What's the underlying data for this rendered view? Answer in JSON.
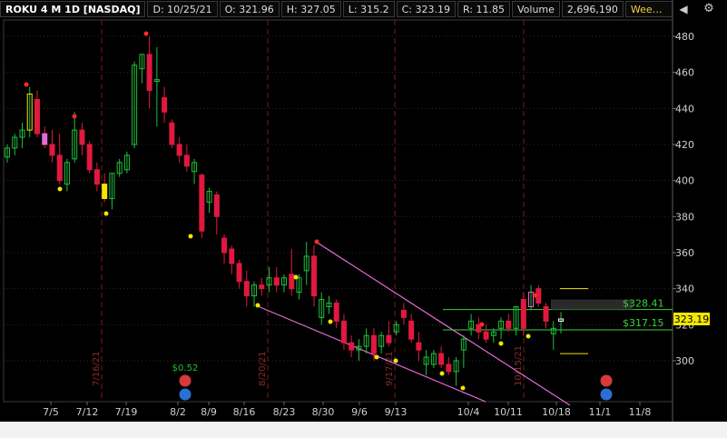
{
  "header": {
    "symbol": "ROKU 4 M 1D [NASDAQ]",
    "d_label": "D:",
    "d_value": "10/25/21",
    "o_label": "O:",
    "o_value": "321.96",
    "h_label": "H:",
    "h_value": "327.05",
    "l_label": "L:",
    "l_value": "315.2",
    "c_label": "C:",
    "c_value": "323.19",
    "r_label": "R:",
    "r_value": "11.85",
    "volume_label": "Volume",
    "volume_value": "2,696,190",
    "study_label": "WeeklyHighLowPlot (WEEK,..."
  },
  "icons": {
    "collapse": "chevron-left-icon",
    "settings": "gear-icon"
  },
  "price_axis": {
    "ticks": [
      "480",
      "460",
      "440",
      "420",
      "400",
      "380",
      "360",
      "340",
      "320",
      "300"
    ],
    "last_price": "323.19"
  },
  "date_axis": {
    "labels": [
      "7/5",
      "7/12",
      "7/19",
      "8/2",
      "8/9",
      "8/16",
      "8/23",
      "8/30",
      "9/6",
      "9/13",
      "10/4",
      "10/11",
      "10/18",
      "11/1",
      "11/8"
    ]
  },
  "annotations": {
    "weekly_high": "$328.41",
    "weekly_low": "$317.15",
    "dividend": "$0.52",
    "earnings_markers": [
      "7/16/21",
      "8/20/21",
      "9/17/21",
      "10/15/21"
    ]
  },
  "colors": {
    "up": "#1fbf3a",
    "down": "#e0193f",
    "magenta": "#e06bd6",
    "yellow": "#f2e600",
    "green_line": "#3ecf3e",
    "price_tag": "#f2e600"
  },
  "chart_data": {
    "type": "candlestick",
    "ylim": [
      280,
      490
    ],
    "candles": [
      {
        "o": 413,
        "h": 420,
        "l": 410,
        "c": 418
      },
      {
        "o": 418,
        "h": 426,
        "l": 414,
        "c": 424
      },
      {
        "o": 424,
        "h": 432,
        "l": 418,
        "c": 428
      },
      {
        "o": 428,
        "h": 452,
        "l": 424,
        "c": 448
      },
      {
        "o": 445,
        "h": 450,
        "l": 424,
        "c": 426
      },
      {
        "o": 426,
        "h": 430,
        "l": 418,
        "c": 420
      },
      {
        "o": 420,
        "h": 428,
        "l": 410,
        "c": 414
      },
      {
        "o": 414,
        "h": 426,
        "l": 398,
        "c": 400
      },
      {
        "o": 398,
        "h": 412,
        "l": 394,
        "c": 410
      },
      {
        "o": 412,
        "h": 438,
        "l": 410,
        "c": 428
      },
      {
        "o": 428,
        "h": 432,
        "l": 414,
        "c": 420
      },
      {
        "o": 420,
        "h": 422,
        "l": 404,
        "c": 406
      },
      {
        "o": 406,
        "h": 410,
        "l": 394,
        "c": 398
      },
      {
        "o": 398,
        "h": 404,
        "l": 388,
        "c": 390
      },
      {
        "o": 390,
        "h": 404,
        "l": 384,
        "c": 404
      },
      {
        "o": 404,
        "h": 412,
        "l": 402,
        "c": 410
      },
      {
        "o": 406,
        "h": 416,
        "l": 404,
        "c": 414
      },
      {
        "o": 420,
        "h": 466,
        "l": 418,
        "c": 464
      },
      {
        "o": 462,
        "h": 470,
        "l": 454,
        "c": 470
      },
      {
        "o": 470,
        "h": 480,
        "l": 440,
        "c": 450
      },
      {
        "o": 455,
        "h": 474,
        "l": 430,
        "c": 456
      },
      {
        "o": 446,
        "h": 452,
        "l": 432,
        "c": 438
      },
      {
        "o": 432,
        "h": 434,
        "l": 418,
        "c": 420
      },
      {
        "o": 420,
        "h": 424,
        "l": 410,
        "c": 414
      },
      {
        "o": 414,
        "h": 420,
        "l": 405,
        "c": 408
      },
      {
        "o": 405,
        "h": 412,
        "l": 398,
        "c": 410
      },
      {
        "o": 403,
        "h": 404,
        "l": 368,
        "c": 372
      },
      {
        "o": 388,
        "h": 396,
        "l": 382,
        "c": 394
      },
      {
        "o": 392,
        "h": 394,
        "l": 370,
        "c": 380
      },
      {
        "o": 368,
        "h": 370,
        "l": 354,
        "c": 360
      },
      {
        "o": 362,
        "h": 364,
        "l": 348,
        "c": 354
      },
      {
        "o": 354,
        "h": 356,
        "l": 340,
        "c": 344
      },
      {
        "o": 344,
        "h": 350,
        "l": 330,
        "c": 336
      },
      {
        "o": 336,
        "h": 344,
        "l": 330,
        "c": 342
      },
      {
        "o": 342,
        "h": 346,
        "l": 336,
        "c": 340
      },
      {
        "o": 342,
        "h": 352,
        "l": 338,
        "c": 346
      },
      {
        "o": 346,
        "h": 352,
        "l": 338,
        "c": 342
      },
      {
        "o": 342,
        "h": 348,
        "l": 338,
        "c": 346
      },
      {
        "o": 348,
        "h": 362,
        "l": 336,
        "c": 340
      },
      {
        "o": 338,
        "h": 348,
        "l": 334,
        "c": 346
      },
      {
        "o": 350,
        "h": 366,
        "l": 342,
        "c": 358
      },
      {
        "o": 358,
        "h": 364,
        "l": 330,
        "c": 336
      },
      {
        "o": 324,
        "h": 338,
        "l": 320,
        "c": 334
      },
      {
        "o": 330,
        "h": 336,
        "l": 326,
        "c": 332
      },
      {
        "o": 332,
        "h": 334,
        "l": 318,
        "c": 322
      },
      {
        "o": 322,
        "h": 326,
        "l": 306,
        "c": 310
      },
      {
        "o": 310,
        "h": 314,
        "l": 302,
        "c": 306
      },
      {
        "o": 306,
        "h": 312,
        "l": 300,
        "c": 308
      },
      {
        "o": 308,
        "h": 318,
        "l": 304,
        "c": 314
      },
      {
        "o": 314,
        "h": 318,
        "l": 300,
        "c": 304
      },
      {
        "o": 308,
        "h": 316,
        "l": 304,
        "c": 314
      },
      {
        "o": 314,
        "h": 322,
        "l": 308,
        "c": 310
      },
      {
        "o": 316,
        "h": 322,
        "l": 314,
        "c": 320
      },
      {
        "o": 328,
        "h": 332,
        "l": 320,
        "c": 324
      },
      {
        "o": 322,
        "h": 326,
        "l": 310,
        "c": 312
      },
      {
        "o": 310,
        "h": 316,
        "l": 300,
        "c": 306
      },
      {
        "o": 298,
        "h": 306,
        "l": 292,
        "c": 302
      },
      {
        "o": 298,
        "h": 306,
        "l": 296,
        "c": 304
      },
      {
        "o": 304,
        "h": 308,
        "l": 296,
        "c": 298
      },
      {
        "o": 298,
        "h": 302,
        "l": 292,
        "c": 294
      },
      {
        "o": 294,
        "h": 302,
        "l": 286,
        "c": 300
      },
      {
        "o": 306,
        "h": 314,
        "l": 296,
        "c": 312
      },
      {
        "o": 318,
        "h": 326,
        "l": 314,
        "c": 322
      },
      {
        "o": 320,
        "h": 324,
        "l": 312,
        "c": 316
      },
      {
        "o": 316,
        "h": 320,
        "l": 310,
        "c": 312
      },
      {
        "o": 314,
        "h": 318,
        "l": 310,
        "c": 316
      },
      {
        "o": 318,
        "h": 324,
        "l": 312,
        "c": 322
      },
      {
        "o": 322,
        "h": 326,
        "l": 316,
        "c": 318
      },
      {
        "o": 318,
        "h": 330,
        "l": 314,
        "c": 330
      },
      {
        "o": 334,
        "h": 338,
        "l": 314,
        "c": 318
      },
      {
        "o": 330,
        "h": 342,
        "l": 328,
        "c": 338
      },
      {
        "o": 340,
        "h": 342,
        "l": 330,
        "c": 332
      },
      {
        "o": 330,
        "h": 332,
        "l": 318,
        "c": 322
      },
      {
        "o": 315,
        "h": 322,
        "l": 306,
        "c": 318
      },
      {
        "o": 321.96,
        "h": 327.05,
        "l": 315.2,
        "c": 323.19
      }
    ]
  }
}
